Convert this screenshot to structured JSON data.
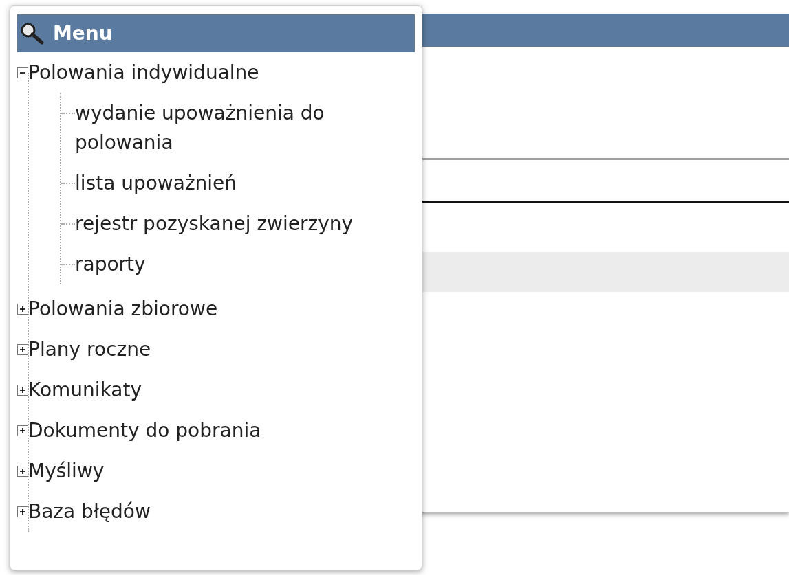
{
  "menu": {
    "title": "Menu",
    "items": [
      {
        "label": "Polowania indywidualne",
        "expanded": true,
        "children": [
          {
            "label": "wydanie upoważnienia do polowania"
          },
          {
            "label": "lista upoważnień"
          },
          {
            "label": "rejestr pozyskanej zwierzyny"
          },
          {
            "label": "raporty"
          }
        ]
      },
      {
        "label": "Polowania zbiorowe",
        "expanded": false
      },
      {
        "label": "Plany roczne",
        "expanded": false
      },
      {
        "label": "Komunikaty",
        "expanded": false
      },
      {
        "label": "Dokumenty do pobrania",
        "expanded": false
      },
      {
        "label": "Myśliwy",
        "expanded": false
      },
      {
        "label": "Baza błędów",
        "expanded": false
      }
    ]
  }
}
